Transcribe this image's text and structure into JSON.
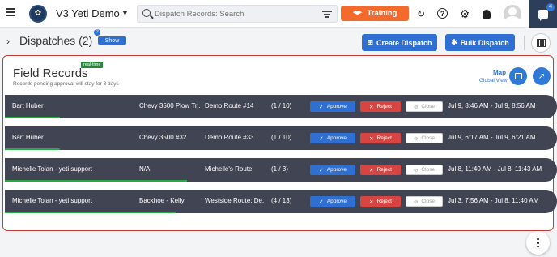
{
  "app": {
    "title": "V3 Yeti Demo",
    "search_placeholder": "Dispatch Records: Search",
    "training_label": "Training",
    "chat_count": "4"
  },
  "header": {
    "section_title": "Dispatches (2)",
    "show_label": "Show",
    "help_badge": "?",
    "create_dispatch_label": "Create Dispatch",
    "bulk_dispatch_label": "Bulk Dispatch"
  },
  "panel": {
    "title": "Field Records",
    "realtime_badge": "real-time",
    "subtitle": "Records pending approval will stay for 3 days",
    "map_label": "Map",
    "global_view_label": "Global View"
  },
  "row_actions": {
    "approve": "Approve",
    "reject": "Reject",
    "close": "Close"
  },
  "records": [
    {
      "name": "Bart Huber",
      "vehicle": "Chevy 3500 Plow Tr...",
      "route": "Demo Route #14",
      "count": "(1 / 10)",
      "time": "Jul 9, 8:46 AM - Jul 9, 8:56 AM",
      "progress": 0.1
    },
    {
      "name": "Bart Huber",
      "vehicle": "Chevy 3500 #32",
      "route": "Demo Route #33",
      "count": "(1 / 10)",
      "time": "Jul 9, 6:17 AM - Jul 9, 6:21 AM",
      "progress": 0.1
    },
    {
      "name": "Michelle Tolan - yeti support",
      "vehicle": "N/A",
      "route": "Michelle's Route",
      "count": "(1 / 3)",
      "time": "Jul 8, 11:40 AM - Jul 8, 11:43 AM",
      "progress": 0.33
    },
    {
      "name": "Michelle Tolan - yeti support",
      "vehicle": "Backhoe - Kelly",
      "route": "Westside Route; De...",
      "count": "(4 / 13)",
      "time": "Jul 3, 7:56 AM - Jul 8, 11:40 AM",
      "progress": 0.31
    }
  ],
  "colors": {
    "accent": "#2f6fd1",
    "training": "#f26b2c",
    "row_bg": "#414453",
    "reject": "#d64541",
    "progress": "#28a745",
    "panel_border": "#c23b3b"
  }
}
